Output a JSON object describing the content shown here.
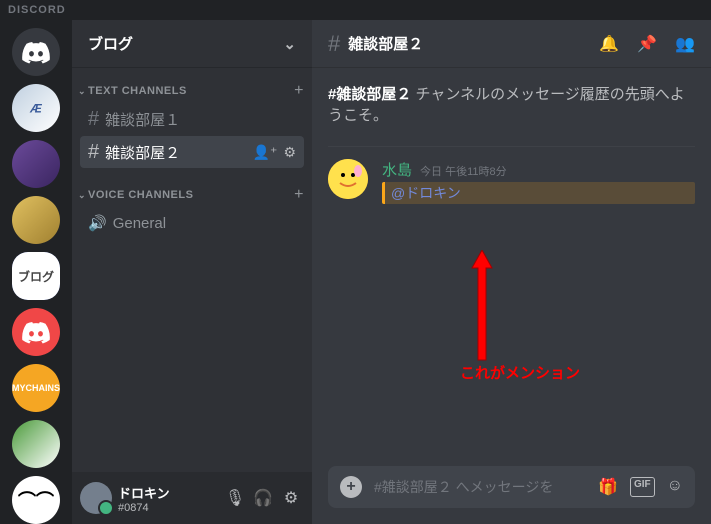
{
  "app_name": "DISCORD",
  "server": {
    "name": "ブログ",
    "selected_label": "ブログ"
  },
  "channel_categories": {
    "text": {
      "label": "TEXT CHANNELS"
    },
    "voice": {
      "label": "VOICE CHANNELS"
    }
  },
  "text_channels": [
    {
      "name": "雑談部屋１"
    },
    {
      "name": "雑談部屋２",
      "active": true
    }
  ],
  "voice_channels": [
    {
      "name": "General"
    }
  ],
  "user": {
    "name": "ドロキン",
    "tag": "#0874"
  },
  "current_channel": {
    "name": "雑談部屋２",
    "welcome_prefix": "#雑談部屋２",
    "welcome_text": "チャンネルのメッセージ履歴の先頭へようこそ。"
  },
  "message": {
    "author": "水島",
    "timestamp": "今日 午後11時8分",
    "mention": "@ドロキン"
  },
  "annotation": "これがメンション",
  "input_placeholder": "#雑談部屋２ へメッセージを",
  "gif_label": "GIF"
}
